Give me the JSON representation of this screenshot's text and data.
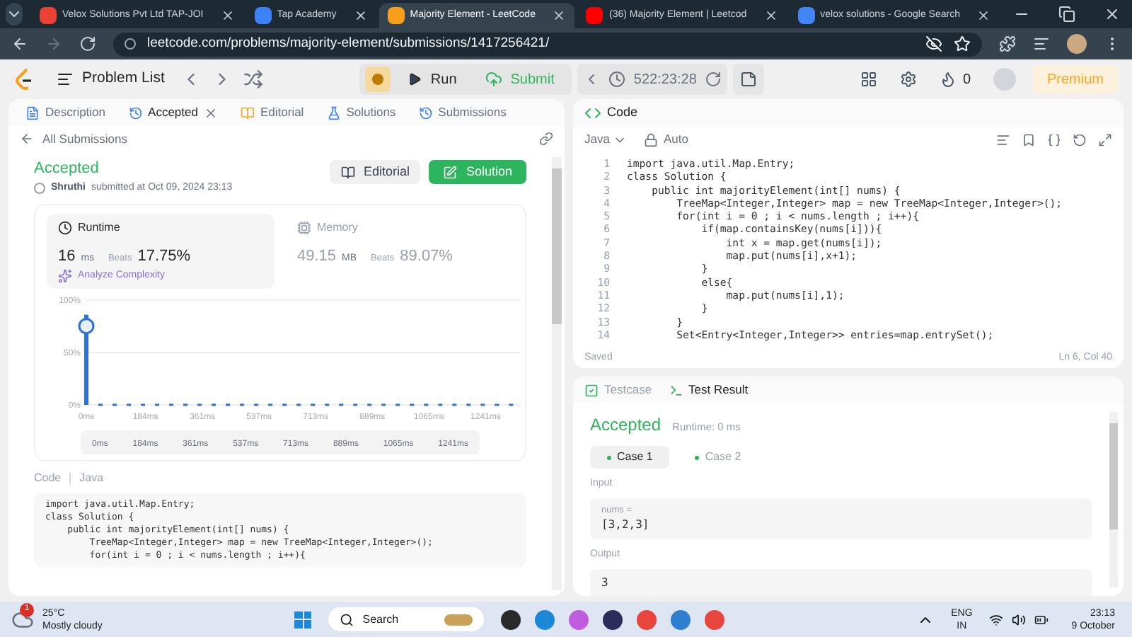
{
  "browser": {
    "tabs": [
      {
        "title": "Velox Solutions Pvt Ltd TAP-JOI",
        "selected": false,
        "kind": "mail"
      },
      {
        "title": "Tap Academy",
        "selected": false,
        "kind": "site"
      },
      {
        "title": "Majority Element - LeetCode",
        "selected": true,
        "kind": "code"
      },
      {
        "title": "(36) Majority Element | Leetcod",
        "selected": false,
        "kind": "video"
      },
      {
        "title": "velox solutions - Google Search",
        "selected": false,
        "kind": "search"
      }
    ],
    "url": "leetcode.com/problems/majority-element/submissions/1417256421/"
  },
  "toolbar": {
    "problem_list": "Problem List",
    "run": "Run",
    "submit": "Submit",
    "timer": "522:23:28",
    "streak": "0",
    "premium": "Premium"
  },
  "left_tabs": [
    {
      "label": "Description",
      "selected": false,
      "closable": false
    },
    {
      "label": "Accepted",
      "selected": true,
      "closable": true
    },
    {
      "label": "Editorial",
      "selected": false,
      "closable": false
    },
    {
      "label": "Solutions",
      "selected": false,
      "closable": false
    },
    {
      "label": "Submissions",
      "selected": false,
      "closable": false
    }
  ],
  "back": "All Submissions",
  "submission": {
    "status": "Accepted",
    "user": "Shruthi",
    "submitted": "submitted at Oct 09, 2024 23:13",
    "editorial": "Editorial",
    "solution": "Solution"
  },
  "stats": [
    {
      "kind": "runtime",
      "label": "Runtime",
      "value": "16",
      "unit": "ms",
      "beats_label": "Beats",
      "beats": "17.75%",
      "analyze": "Analyze Complexity",
      "selected": true
    },
    {
      "kind": "memory",
      "label": "Memory",
      "value": "49.15",
      "unit": "MB",
      "beats_label": "Beats",
      "beats": "89.07%",
      "selected": false
    }
  ],
  "chart_data": {
    "type": "bar",
    "x": [
      0,
      44,
      88,
      132,
      176,
      220,
      264,
      308,
      352,
      396,
      440,
      484,
      528,
      572,
      616,
      660,
      704,
      748,
      792,
      836,
      880,
      924,
      968,
      1012,
      1056,
      1100,
      1144,
      1188,
      1232,
      1276,
      1320
    ],
    "series": [
      {
        "color": "#2c72d9",
        "values": [
          86,
          1,
          1,
          1,
          1,
          1,
          1,
          1,
          1,
          1,
          1,
          1,
          1,
          1,
          1,
          1,
          1,
          1,
          1,
          1,
          1,
          1,
          1,
          1,
          1,
          1,
          1,
          1,
          1,
          1,
          1
        ]
      }
    ],
    "xlim": [
      0,
      1350
    ],
    "ylim": [
      0,
      100
    ],
    "xticks": [
      {
        "value": 0,
        "label": "0ms"
      },
      {
        "value": 184,
        "label": "184ms"
      },
      {
        "value": 361,
        "label": "361ms"
      },
      {
        "value": 537,
        "label": "537ms"
      },
      {
        "value": 713,
        "label": "713ms"
      },
      {
        "value": 889,
        "label": "889ms"
      },
      {
        "value": 1065,
        "label": "1065ms"
      },
      {
        "value": 1241,
        "label": "1241ms"
      }
    ],
    "yticks": [
      {
        "value": 0,
        "label": "0%"
      },
      {
        "value": 50,
        "label": "50%"
      },
      {
        "value": 100,
        "label": "100%"
      }
    ]
  },
  "range_labels": [
    "0ms",
    "184ms",
    "361ms",
    "537ms",
    "713ms",
    "889ms",
    "1065ms",
    "1241ms"
  ],
  "code_header": {
    "label": "Code",
    "language": "Java"
  },
  "code_lines": [
    "import java.util.Map.Entry;",
    "class Solution {",
    "    public int majorityElement(int[] nums) {",
    "        TreeMap<Integer,Integer> map = new TreeMap<Integer,Integer>();",
    "        for(int i = 0 ; i < nums.length ; i++){"
  ],
  "editor": {
    "title": "Code",
    "language": "Java",
    "mode": "Auto",
    "lines": [
      {
        "n": "1",
        "text": "import java.util.Map.Entry;"
      },
      {
        "n": "2",
        "text": "class Solution {"
      },
      {
        "n": "3",
        "text": "    public int majorityElement(int[] nums) {"
      },
      {
        "n": "4",
        "text": "        TreeMap<Integer,Integer> map = new TreeMap<Integer,Integer>();"
      },
      {
        "n": "5",
        "text": "        for(int i = 0 ; i < nums.length ; i++){"
      },
      {
        "n": "6",
        "text": "            if(map.containsKey(nums[i])){"
      },
      {
        "n": "7",
        "text": "                int x = map.get(nums[i]);"
      },
      {
        "n": "8",
        "text": "                map.put(nums[i],x+1);"
      },
      {
        "n": "9",
        "text": "            }"
      },
      {
        "n": "10",
        "text": "            else{"
      },
      {
        "n": "11",
        "text": "                map.put(nums[i],1);"
      },
      {
        "n": "12",
        "text": "            }"
      },
      {
        "n": "13",
        "text": "        }"
      },
      {
        "n": "14",
        "text": "        Set<Entry<Integer,Integer>> entries=map.entrySet();"
      }
    ],
    "saved": "Saved",
    "position": "Ln 6, Col 40"
  },
  "results": {
    "tabs": [
      {
        "label": "Testcase",
        "selected": false
      },
      {
        "label": "Test Result",
        "selected": true
      }
    ],
    "status": "Accepted",
    "runtime": "Runtime: 0 ms",
    "cases": [
      {
        "label": "Case 1",
        "selected": true
      },
      {
        "label": "Case 2",
        "selected": false
      }
    ],
    "input_label": "Input",
    "param": "nums =",
    "input": "[3,2,3]",
    "output_label": "Output",
    "output": "3"
  },
  "taskbar": {
    "badge": "1",
    "temperature": "25°C",
    "weather": "Mostly cloudy",
    "search": "Search",
    "lang": "ENG",
    "region": "IN",
    "time": "23:13",
    "date": "9 October"
  }
}
